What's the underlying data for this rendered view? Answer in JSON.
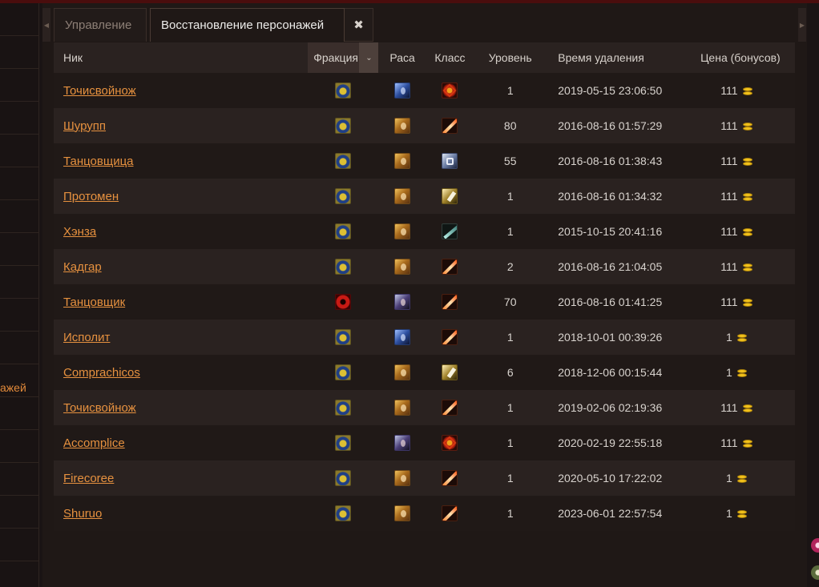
{
  "sidebar": {
    "partial_label": "ажей"
  },
  "tabs": [
    {
      "label": "Управление",
      "active": false
    },
    {
      "label": "Восстановление персонажей",
      "active": true
    }
  ],
  "tab_close_icon": "close-icon",
  "table": {
    "columns": {
      "nick": "Ник",
      "faction": "Фракция",
      "race": "Раса",
      "class": "Класс",
      "level": "Уровень",
      "deleted_at": "Время удаления",
      "price": "Цена (бонусов)"
    },
    "rows": [
      {
        "nick": "Точисвойнож",
        "faction": "alliance",
        "race": "r-blue",
        "class": "c-fire",
        "level": "1",
        "deleted_at": "2019-05-15 23:06:50",
        "price": "111"
      },
      {
        "nick": "Шурупп",
        "faction": "alliance",
        "race": "r-golden",
        "class": "c-slash",
        "level": "80",
        "deleted_at": "2016-08-16 01:57:29",
        "price": "111"
      },
      {
        "nick": "Танцовщица",
        "faction": "alliance",
        "race": "r-golden",
        "class": "c-grey",
        "level": "55",
        "deleted_at": "2016-08-16 01:38:43",
        "price": "111"
      },
      {
        "nick": "Протомен",
        "faction": "alliance",
        "race": "r-golden",
        "class": "c-gold",
        "level": "1",
        "deleted_at": "2016-08-16 01:34:32",
        "price": "111"
      },
      {
        "nick": "Хэнза",
        "faction": "alliance",
        "race": "r-golden",
        "class": "c-teal",
        "level": "1",
        "deleted_at": "2015-10-15 20:41:16",
        "price": "111"
      },
      {
        "nick": "Кадгар",
        "faction": "alliance",
        "race": "r-golden",
        "class": "c-slash",
        "level": "2",
        "deleted_at": "2016-08-16 21:04:05",
        "price": "111"
      },
      {
        "nick": "Танцовщик",
        "faction": "horde",
        "race": "r-dark",
        "class": "c-slash",
        "level": "70",
        "deleted_at": "2016-08-16 01:41:25",
        "price": "111"
      },
      {
        "nick": "Исполит",
        "faction": "alliance",
        "race": "r-blue",
        "class": "c-slash",
        "level": "1",
        "deleted_at": "2018-10-01 00:39:26",
        "price": "1"
      },
      {
        "nick": "Comprachicos",
        "faction": "alliance",
        "race": "r-golden",
        "class": "c-gold",
        "level": "6",
        "deleted_at": "2018-12-06 00:15:44",
        "price": "1"
      },
      {
        "nick": "Точисвойнож",
        "faction": "alliance",
        "race": "r-golden",
        "class": "c-slash",
        "level": "1",
        "deleted_at": "2019-02-06 02:19:36",
        "price": "111"
      },
      {
        "nick": "Accomplice",
        "faction": "alliance",
        "race": "r-dark",
        "class": "c-fire",
        "level": "1",
        "deleted_at": "2020-02-19 22:55:18",
        "price": "111"
      },
      {
        "nick": "Firecoree",
        "faction": "alliance",
        "race": "r-golden",
        "class": "c-slash",
        "level": "1",
        "deleted_at": "2020-05-10 17:22:02",
        "price": "1"
      },
      {
        "nick": "Shuruo",
        "faction": "alliance",
        "race": "r-golden",
        "class": "c-slash",
        "level": "1",
        "deleted_at": "2023-06-01 22:57:54",
        "price": "1"
      }
    ]
  }
}
